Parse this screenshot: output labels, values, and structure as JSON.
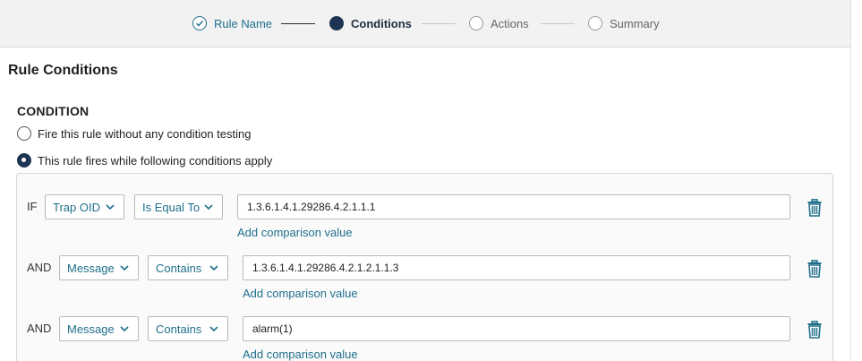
{
  "wizard": {
    "steps": [
      {
        "label": "Rule Name",
        "state": "done"
      },
      {
        "label": "Conditions",
        "state": "active"
      },
      {
        "label": "Actions",
        "state": "todo"
      },
      {
        "label": "Summary",
        "state": "todo"
      }
    ]
  },
  "page": {
    "title": "Rule Conditions",
    "condition_heading": "CONDITION"
  },
  "radios": {
    "no_condition": "Fire this rule without any condition testing",
    "with_conditions": "This rule fires while following conditions apply",
    "selected": "with_conditions"
  },
  "conditions": [
    {
      "connector": "IF",
      "field": "Trap OID",
      "operator": "Is Equal To",
      "value": "1.3.6.1.4.1.29286.4.2.1.1.1",
      "add_link": "Add comparison value"
    },
    {
      "connector": "AND",
      "field": "Message",
      "operator": "Contains",
      "value": "1.3.6.1.4.1.29286.4.2.1.2.1.1.3",
      "add_link": "Add comparison value"
    },
    {
      "connector": "AND",
      "field": "Message",
      "operator": "Contains",
      "value": "alarm(1)",
      "add_link": "Add comparison value"
    }
  ],
  "colors": {
    "accent": "#1f6f8b",
    "active_step": "#1c3552"
  },
  "icons": {
    "step_done": "check-circle-icon",
    "dropdown": "chevron-down-icon",
    "delete": "trash-icon"
  }
}
